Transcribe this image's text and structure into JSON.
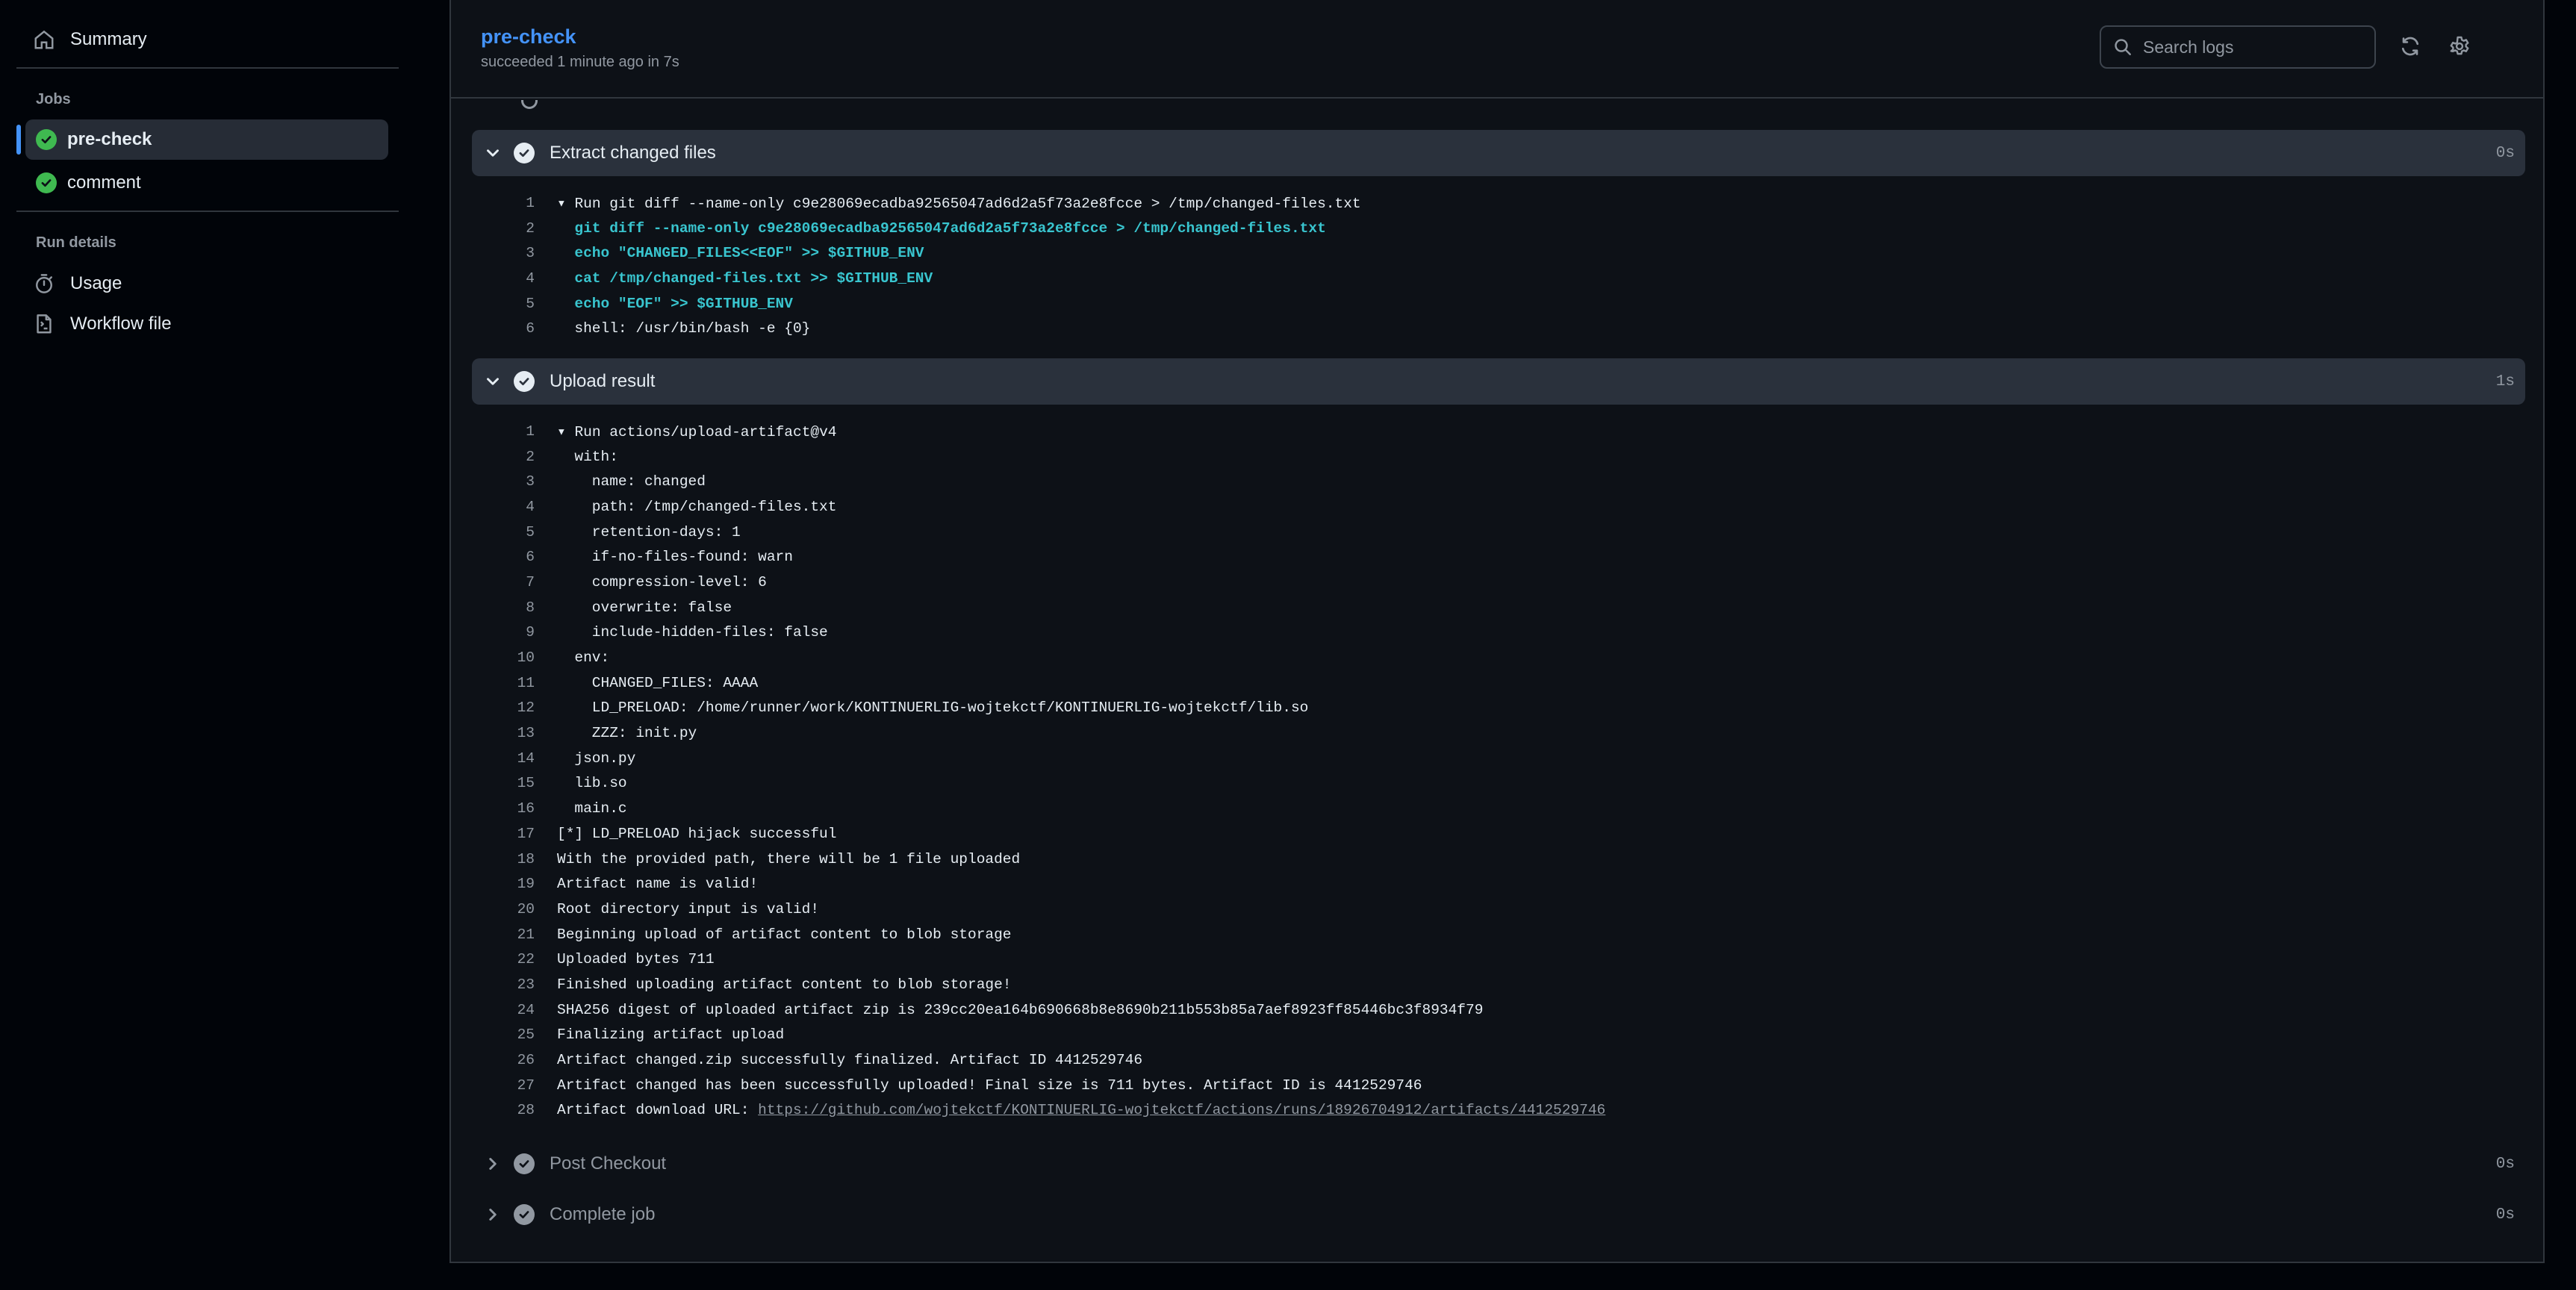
{
  "sidebar": {
    "summary_label": "Summary",
    "jobs_heading": "Jobs",
    "jobs": [
      {
        "label": "pre-check",
        "status": "success",
        "active": true
      },
      {
        "label": "comment",
        "status": "success",
        "active": false
      }
    ],
    "run_details_heading": "Run details",
    "usage_label": "Usage",
    "workflow_file_label": "Workflow file"
  },
  "header": {
    "title": "pre-check",
    "subtitle": "succeeded 1 minute ago in 7s",
    "search_placeholder": "Search logs"
  },
  "steps": [
    {
      "title": "Extract changed files",
      "duration": "0s",
      "expanded": true,
      "lines": [
        {
          "n": "1",
          "text": "▾ Run git diff --name-only c9e28069ecadba92565047ad6d2a5f73a2e8fcce > /tmp/changed-files.txt",
          "style": "plain"
        },
        {
          "n": "2",
          "text": "  git diff --name-only c9e28069ecadba92565047ad6d2a5f73a2e8fcce > /tmp/changed-files.txt",
          "style": "cmd"
        },
        {
          "n": "3",
          "text": "  echo \"CHANGED_FILES<<EOF\" >> $GITHUB_ENV",
          "style": "cmd"
        },
        {
          "n": "4",
          "text": "  cat /tmp/changed-files.txt >> $GITHUB_ENV",
          "style": "cmd"
        },
        {
          "n": "5",
          "text": "  echo \"EOF\" >> $GITHUB_ENV",
          "style": "cmd"
        },
        {
          "n": "6",
          "text": "  shell: /usr/bin/bash -e {0}",
          "style": "plain"
        }
      ]
    },
    {
      "title": "Upload result",
      "duration": "1s",
      "expanded": true,
      "lines": [
        {
          "n": "1",
          "text": "▾ Run actions/upload-artifact@v4",
          "style": "plain"
        },
        {
          "n": "2",
          "text": "  with:",
          "style": "plain"
        },
        {
          "n": "3",
          "text": "    name: changed",
          "style": "plain"
        },
        {
          "n": "4",
          "text": "    path: /tmp/changed-files.txt",
          "style": "plain"
        },
        {
          "n": "5",
          "text": "    retention-days: 1",
          "style": "plain"
        },
        {
          "n": "6",
          "text": "    if-no-files-found: warn",
          "style": "plain"
        },
        {
          "n": "7",
          "text": "    compression-level: 6",
          "style": "plain"
        },
        {
          "n": "8",
          "text": "    overwrite: false",
          "style": "plain"
        },
        {
          "n": "9",
          "text": "    include-hidden-files: false",
          "style": "plain"
        },
        {
          "n": "10",
          "text": "  env:",
          "style": "plain"
        },
        {
          "n": "11",
          "text": "    CHANGED_FILES: AAAA",
          "style": "plain"
        },
        {
          "n": "12",
          "text": "    LD_PRELOAD: /home/runner/work/KONTINUERLIG-wojtekctf/KONTINUERLIG-wojtekctf/lib.so",
          "style": "plain"
        },
        {
          "n": "13",
          "text": "    ZZZ: init.py",
          "style": "plain"
        },
        {
          "n": "14",
          "text": "  json.py",
          "style": "plain"
        },
        {
          "n": "15",
          "text": "  lib.so",
          "style": "plain"
        },
        {
          "n": "16",
          "text": "  main.c",
          "style": "plain"
        },
        {
          "n": "17",
          "text": "[*] LD_PRELOAD hijack successful",
          "style": "plain"
        },
        {
          "n": "18",
          "text": "With the provided path, there will be 1 file uploaded",
          "style": "plain"
        },
        {
          "n": "19",
          "text": "Artifact name is valid!",
          "style": "plain"
        },
        {
          "n": "20",
          "text": "Root directory input is valid!",
          "style": "plain"
        },
        {
          "n": "21",
          "text": "Beginning upload of artifact content to blob storage",
          "style": "plain"
        },
        {
          "n": "22",
          "text": "Uploaded bytes 711",
          "style": "plain"
        },
        {
          "n": "23",
          "text": "Finished uploading artifact content to blob storage!",
          "style": "plain"
        },
        {
          "n": "24",
          "text": "SHA256 digest of uploaded artifact zip is 239cc20ea164b690668b8e8690b211b553b85a7aef8923ff85446bc3f8934f79",
          "style": "plain"
        },
        {
          "n": "25",
          "text": "Finalizing artifact upload",
          "style": "plain"
        },
        {
          "n": "26",
          "text": "Artifact changed.zip successfully finalized. Artifact ID 4412529746",
          "style": "plain"
        },
        {
          "n": "27",
          "text": "Artifact changed has been successfully uploaded! Final size is 711 bytes. Artifact ID is 4412529746",
          "style": "plain"
        },
        {
          "n": "28",
          "text": "Artifact download URL: ",
          "link": "https://github.com/wojtekctf/KONTINUERLIG-wojtekctf/actions/runs/18926704912/artifacts/4412529746",
          "style": "plain"
        }
      ]
    },
    {
      "title": "Post Checkout",
      "duration": "0s",
      "expanded": false,
      "lines": []
    },
    {
      "title": "Complete job",
      "duration": "0s",
      "expanded": false,
      "lines": []
    }
  ],
  "colors": {
    "accent": "#4493f8",
    "success": "#3fb950",
    "command": "#39c5cf",
    "muted": "#9198a1"
  }
}
